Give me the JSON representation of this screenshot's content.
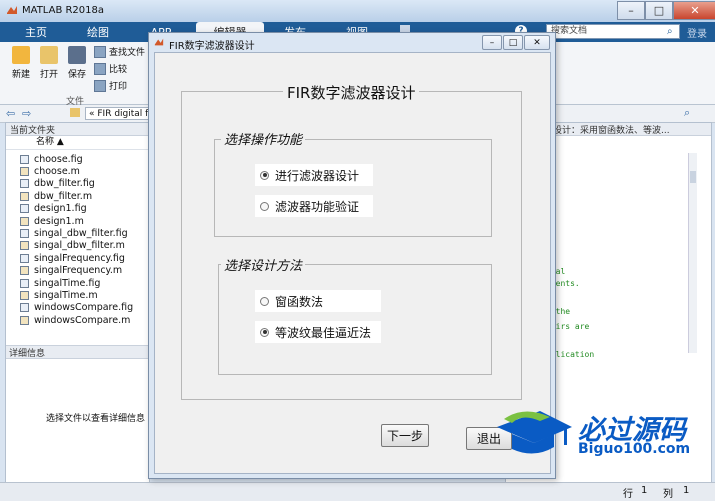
{
  "app": {
    "title": "MATLAB R2018a"
  },
  "tabs": [
    "主页",
    "绘图",
    "APP",
    "编辑器",
    "发布",
    "视图"
  ],
  "search": {
    "placeholder": "搜索文档",
    "login": "登录"
  },
  "ribbon": {
    "new": "新建",
    "open": "打开",
    "save": "保存",
    "find_files": "查找文件",
    "compare": "比较",
    "print": "打印",
    "group_label": "文件"
  },
  "address": {
    "path": "« FIR digital fil"
  },
  "left_panel": {
    "header": "当前文件夹",
    "column": "名称",
    "files": [
      {
        "name": "choose.fig",
        "kind": "fig"
      },
      {
        "name": "choose.m",
        "kind": "m"
      },
      {
        "name": "dbw_filter.fig",
        "kind": "fig"
      },
      {
        "name": "dbw_filter.m",
        "kind": "m"
      },
      {
        "name": "design1.fig",
        "kind": "fig"
      },
      {
        "name": "design1.m",
        "kind": "m"
      },
      {
        "name": "singal_dbw_filter.fig",
        "kind": "fig"
      },
      {
        "name": "singal_dbw_filter.m",
        "kind": "m"
      },
      {
        "name": "singalFrequency.fig",
        "kind": "fig"
      },
      {
        "name": "singalFrequency.m",
        "kind": "m"
      },
      {
        "name": "singalTime.fig",
        "kind": "fig"
      },
      {
        "name": "singalTime.m",
        "kind": "m"
      },
      {
        "name": "windowsCompare.fig",
        "kind": "fig"
      },
      {
        "name": "windowsCompare.m",
        "kind": "m"
      }
    ],
    "details_header": "详细信息",
    "details_hint": "选择文件以查看详细信息"
  },
  "editor": {
    "header": "器设计：采用窗函数法、等波...",
    "code_lines": [
      "g",
      "o",
      "ecal",
      "uments.",
      "s the",
      " pairs are",
      "pplication"
    ]
  },
  "status": {
    "row_label": "行",
    "row": "1",
    "col_label": "列",
    "col": "1"
  },
  "dialog": {
    "title": "FIR数字滤波器设计",
    "heading": "FIR数字滤波器设计",
    "group1": {
      "legend": "选择操作功能",
      "options": [
        {
          "label": "进行滤波器设计",
          "selected": true
        },
        {
          "label": "滤波器功能验证",
          "selected": false
        }
      ]
    },
    "group2": {
      "legend": "选择设计方法",
      "options": [
        {
          "label": "窗函数法",
          "selected": false
        },
        {
          "label": "等波纹最佳逼近法",
          "selected": true
        }
      ]
    },
    "next_button": "下一步",
    "exit_button": "退出"
  },
  "watermark": {
    "text": "必过源码",
    "site": "Biguo100.com"
  },
  "colors": {
    "tab_bar": "#1f5c97",
    "dialog_frame": "#dbe6f3",
    "watermark": "#0a5bc4"
  }
}
